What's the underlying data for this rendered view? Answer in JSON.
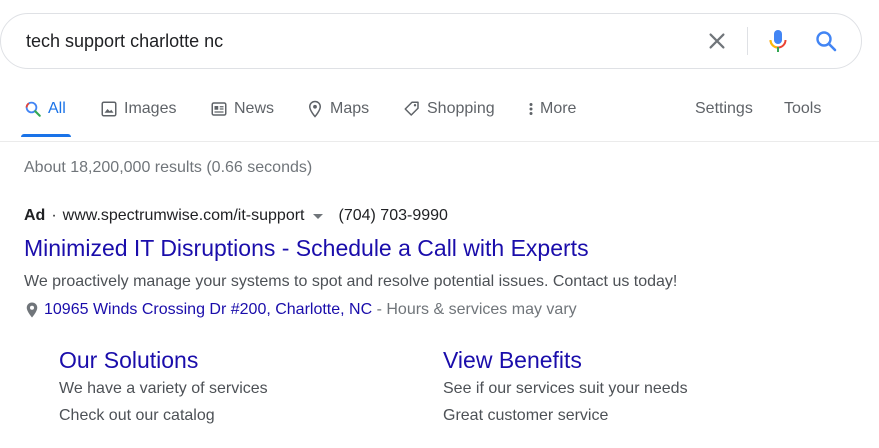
{
  "search": {
    "query": "tech support charlotte nc",
    "icons": [
      "clear-icon",
      "microphone-icon",
      "search-icon"
    ]
  },
  "tabs": [
    {
      "label": "All",
      "icon": "search-icon",
      "active": true
    },
    {
      "label": "Images",
      "icon": "image-icon"
    },
    {
      "label": "News",
      "icon": "news-icon"
    },
    {
      "label": "Maps",
      "icon": "map-pin-icon"
    },
    {
      "label": "Shopping",
      "icon": "tag-icon"
    },
    {
      "label": "More",
      "icon": "more-vertical-icon"
    }
  ],
  "tools": {
    "settings": "Settings",
    "tools": "Tools"
  },
  "result_stats": "About 18,200,000 results (0.66 seconds)",
  "ad": {
    "badge": "Ad",
    "separator": "·",
    "url": "www.spectrumwise.com/it-support",
    "phone": "(704) 703-9990",
    "title": "Minimized IT Disruptions - Schedule a Call with Experts",
    "description": "We proactively manage your systems to spot and resolve potential issues. Contact us today!",
    "address": "10965 Winds Crossing Dr #200, Charlotte, NC",
    "address_sep": " - ",
    "hours": "Hours & services may vary"
  },
  "sitelinks": [
    {
      "title": "Our Solutions",
      "lines": [
        "We have a variety of services",
        "Check out our catalog"
      ]
    },
    {
      "title": "View Benefits",
      "lines": [
        "See if our services suit your needs",
        "Great customer service"
      ]
    }
  ],
  "colors": {
    "link": "#1a0dab",
    "accent": "#1a73e8",
    "muted": "#70757a",
    "text": "#4d5156"
  }
}
